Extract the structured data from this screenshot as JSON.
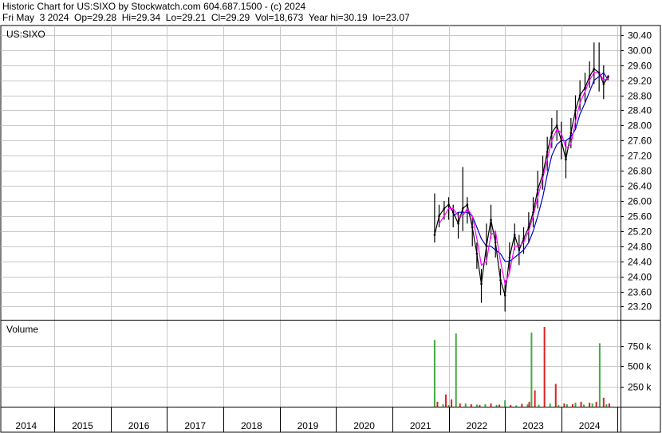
{
  "header": {
    "line1": "Historic Chart for US:SIXO by Stockwatch.com 604.687.1500 - (c) 2024",
    "line2": "Fri May  3 2024  Op=29.28  Hi=29.34  Lo=29.21  Cl=29.29  Vol=18,673  Year hi=30.19  lo=23.07"
  },
  "colors": {
    "price": "#000000",
    "ma_short": "#ff00ff",
    "ma_long": "#0000cc",
    "volume_up": "#44aa44",
    "volume_down": "#dd2222",
    "grid": "#c8c8c8"
  },
  "chart_data": [
    {
      "type": "line",
      "title": "US:SIXO",
      "x_labels": [
        "2014",
        "2015",
        "2016",
        "2017",
        "2018",
        "2019",
        "2020",
        "2021",
        "2022",
        "2023",
        "2024"
      ],
      "y_ticks": [
        23.2,
        23.6,
        24.0,
        24.4,
        24.8,
        25.2,
        25.6,
        26.0,
        26.4,
        26.8,
        27.2,
        27.6,
        28.0,
        28.4,
        28.8,
        29.2,
        29.6,
        30.0,
        30.4
      ],
      "y_tick_labels": [
        "23.20",
        "23.60",
        "24.00",
        "24.40",
        "24.80",
        "25.20",
        "25.60",
        "26.00",
        "26.40",
        "26.80",
        "27.20",
        "27.60",
        "28.00",
        "28.40",
        "28.80",
        "29.20",
        "29.60",
        "30.00",
        "30.40"
      ],
      "ylim": [
        22.85,
        30.65
      ],
      "xlim": [
        2013.55,
        2024.55
      ],
      "grid": true,
      "series": [
        {
          "style": "close",
          "x": [
            2021.25,
            2021.33,
            2021.42,
            2021.5,
            2021.58,
            2021.67,
            2021.75,
            2021.83,
            2021.92,
            2022.0,
            2022.08,
            2022.17,
            2022.25,
            2022.33,
            2022.42,
            2022.5,
            2022.58,
            2022.67,
            2022.75,
            2022.83,
            2022.92,
            2023.0,
            2023.08,
            2023.17,
            2023.25,
            2023.33,
            2023.42,
            2023.5,
            2023.58,
            2023.67,
            2023.75,
            2023.83,
            2023.92,
            2024.0,
            2024.08,
            2024.17,
            2024.25,
            2024.33
          ],
          "y": [
            25.1,
            25.6,
            25.8,
            25.9,
            25.7,
            25.4,
            25.8,
            25.9,
            25.3,
            24.6,
            23.8,
            24.8,
            25.5,
            24.9,
            23.9,
            23.5,
            24.5,
            25.1,
            24.7,
            25.0,
            25.3,
            25.7,
            26.3,
            26.7,
            27.3,
            27.8,
            28.0,
            27.6,
            27.1,
            27.8,
            28.4,
            28.8,
            29.0,
            29.3,
            29.5,
            29.4,
            29.1,
            29.29
          ]
        },
        {
          "style": "high",
          "x": [
            2021.25,
            2021.33,
            2021.42,
            2021.5,
            2021.58,
            2021.67,
            2021.75,
            2021.83,
            2021.92,
            2022.0,
            2022.08,
            2022.17,
            2022.25,
            2022.33,
            2022.42,
            2022.5,
            2022.58,
            2022.67,
            2022.75,
            2022.83,
            2022.92,
            2023.0,
            2023.08,
            2023.17,
            2023.25,
            2023.33,
            2023.42,
            2023.5,
            2023.58,
            2023.67,
            2023.75,
            2023.83,
            2023.92,
            2024.0,
            2024.08,
            2024.17,
            2024.25,
            2024.33
          ],
          "y": [
            26.2,
            25.9,
            26.0,
            26.1,
            25.9,
            25.7,
            26.9,
            26.1,
            25.6,
            24.9,
            24.2,
            25.4,
            25.9,
            25.2,
            24.2,
            23.9,
            24.9,
            25.4,
            25.1,
            25.3,
            25.7,
            26.1,
            26.8,
            27.2,
            27.7,
            28.2,
            28.4,
            28.1,
            27.6,
            28.2,
            28.8,
            29.2,
            29.4,
            29.7,
            30.2,
            30.2,
            29.6,
            29.34
          ]
        },
        {
          "style": "low",
          "x": [
            2021.25,
            2021.33,
            2021.42,
            2021.5,
            2021.58,
            2021.67,
            2021.75,
            2021.83,
            2021.92,
            2022.0,
            2022.08,
            2022.17,
            2022.25,
            2022.33,
            2022.42,
            2022.5,
            2022.58,
            2022.67,
            2022.75,
            2022.83,
            2022.92,
            2023.0,
            2023.08,
            2023.17,
            2023.25,
            2023.33,
            2023.42,
            2023.5,
            2023.58,
            2023.67,
            2023.75,
            2023.83,
            2023.92,
            2024.0,
            2024.08,
            2024.17,
            2024.25,
            2024.33
          ],
          "y": [
            24.9,
            25.3,
            25.5,
            25.5,
            25.3,
            25.0,
            25.2,
            25.4,
            24.8,
            24.2,
            23.3,
            24.3,
            25.0,
            24.5,
            23.5,
            23.07,
            24.1,
            24.7,
            24.3,
            24.6,
            24.9,
            25.3,
            25.8,
            26.3,
            26.8,
            27.4,
            27.6,
            27.1,
            26.6,
            27.4,
            27.9,
            28.4,
            28.6,
            29.0,
            29.1,
            28.9,
            28.7,
            29.21
          ]
        },
        {
          "style": "ma_short",
          "x": [
            2021.33,
            2021.42,
            2021.5,
            2021.58,
            2021.67,
            2021.75,
            2021.83,
            2021.92,
            2022.0,
            2022.08,
            2022.17,
            2022.25,
            2022.33,
            2022.42,
            2022.5,
            2022.58,
            2022.67,
            2022.75,
            2022.83,
            2022.92,
            2023.0,
            2023.08,
            2023.17,
            2023.25,
            2023.33,
            2023.42,
            2023.5,
            2023.58,
            2023.67,
            2023.75,
            2023.83,
            2023.92,
            2024.0,
            2024.08,
            2024.17,
            2024.25,
            2024.33
          ],
          "y": [
            25.4,
            25.6,
            25.8,
            25.8,
            25.6,
            25.6,
            25.8,
            25.6,
            25.0,
            24.3,
            24.4,
            25.1,
            25.2,
            24.4,
            23.8,
            24.1,
            24.8,
            24.8,
            24.9,
            25.2,
            25.6,
            26.1,
            26.6,
            27.1,
            27.6,
            27.9,
            27.8,
            27.4,
            27.5,
            28.1,
            28.6,
            28.9,
            29.2,
            29.4,
            29.4,
            29.2,
            29.25
          ]
        },
        {
          "style": "ma_long",
          "x": [
            2021.58,
            2021.67,
            2021.75,
            2021.83,
            2021.92,
            2022.0,
            2022.08,
            2022.17,
            2022.25,
            2022.33,
            2022.42,
            2022.5,
            2022.58,
            2022.67,
            2022.75,
            2022.83,
            2022.92,
            2023.0,
            2023.08,
            2023.17,
            2023.25,
            2023.33,
            2023.42,
            2023.5,
            2023.58,
            2023.67,
            2023.75,
            2023.83,
            2023.92,
            2024.0,
            2024.08,
            2024.17,
            2024.25,
            2024.33
          ],
          "y": [
            25.6,
            25.7,
            25.7,
            25.7,
            25.6,
            25.3,
            25.0,
            24.8,
            24.8,
            24.7,
            24.6,
            24.4,
            24.4,
            24.5,
            24.6,
            24.7,
            24.9,
            25.2,
            25.6,
            26.1,
            26.7,
            27.2,
            27.5,
            27.6,
            27.6,
            27.7,
            27.9,
            28.3,
            28.6,
            28.9,
            29.2,
            29.3,
            29.4,
            29.2
          ]
        }
      ]
    },
    {
      "type": "bar",
      "title": "Volume",
      "y_ticks": [
        250000,
        500000,
        750000
      ],
      "y_tick_labels": [
        "250 k",
        "500 k",
        "750 k"
      ],
      "ylim": [
        0,
        1000000
      ],
      "series": [
        {
          "name": "up",
          "x": [
            2021.25,
            2021.4,
            2021.5,
            2021.63,
            2021.8,
            2022.0,
            2022.15,
            2022.35,
            2022.5,
            2022.7,
            2022.9,
            2022.97,
            2023.1,
            2023.3,
            2023.45,
            2023.6,
            2023.75,
            2023.9,
            2024.05,
            2024.18,
            2024.3
          ],
          "values": [
            820000,
            30000,
            20000,
            900000,
            40000,
            25000,
            30000,
            20000,
            80000,
            15000,
            30000,
            910000,
            25000,
            40000,
            20000,
            30000,
            50000,
            25000,
            40000,
            780000,
            30000
          ]
        },
        {
          "name": "down",
          "x": [
            2021.3,
            2021.45,
            2021.55,
            2021.7,
            2021.9,
            2022.05,
            2022.25,
            2022.4,
            2022.6,
            2022.8,
            2022.93,
            2023.03,
            2023.2,
            2023.4,
            2023.55,
            2023.7,
            2023.85,
            2024.0,
            2024.12,
            2024.25,
            2024.35
          ],
          "values": [
            60000,
            150000,
            90000,
            40000,
            30000,
            20000,
            40000,
            25000,
            20000,
            35000,
            60000,
            200000,
            980000,
            280000,
            40000,
            30000,
            60000,
            50000,
            60000,
            110000,
            40000
          ]
        }
      ]
    }
  ]
}
